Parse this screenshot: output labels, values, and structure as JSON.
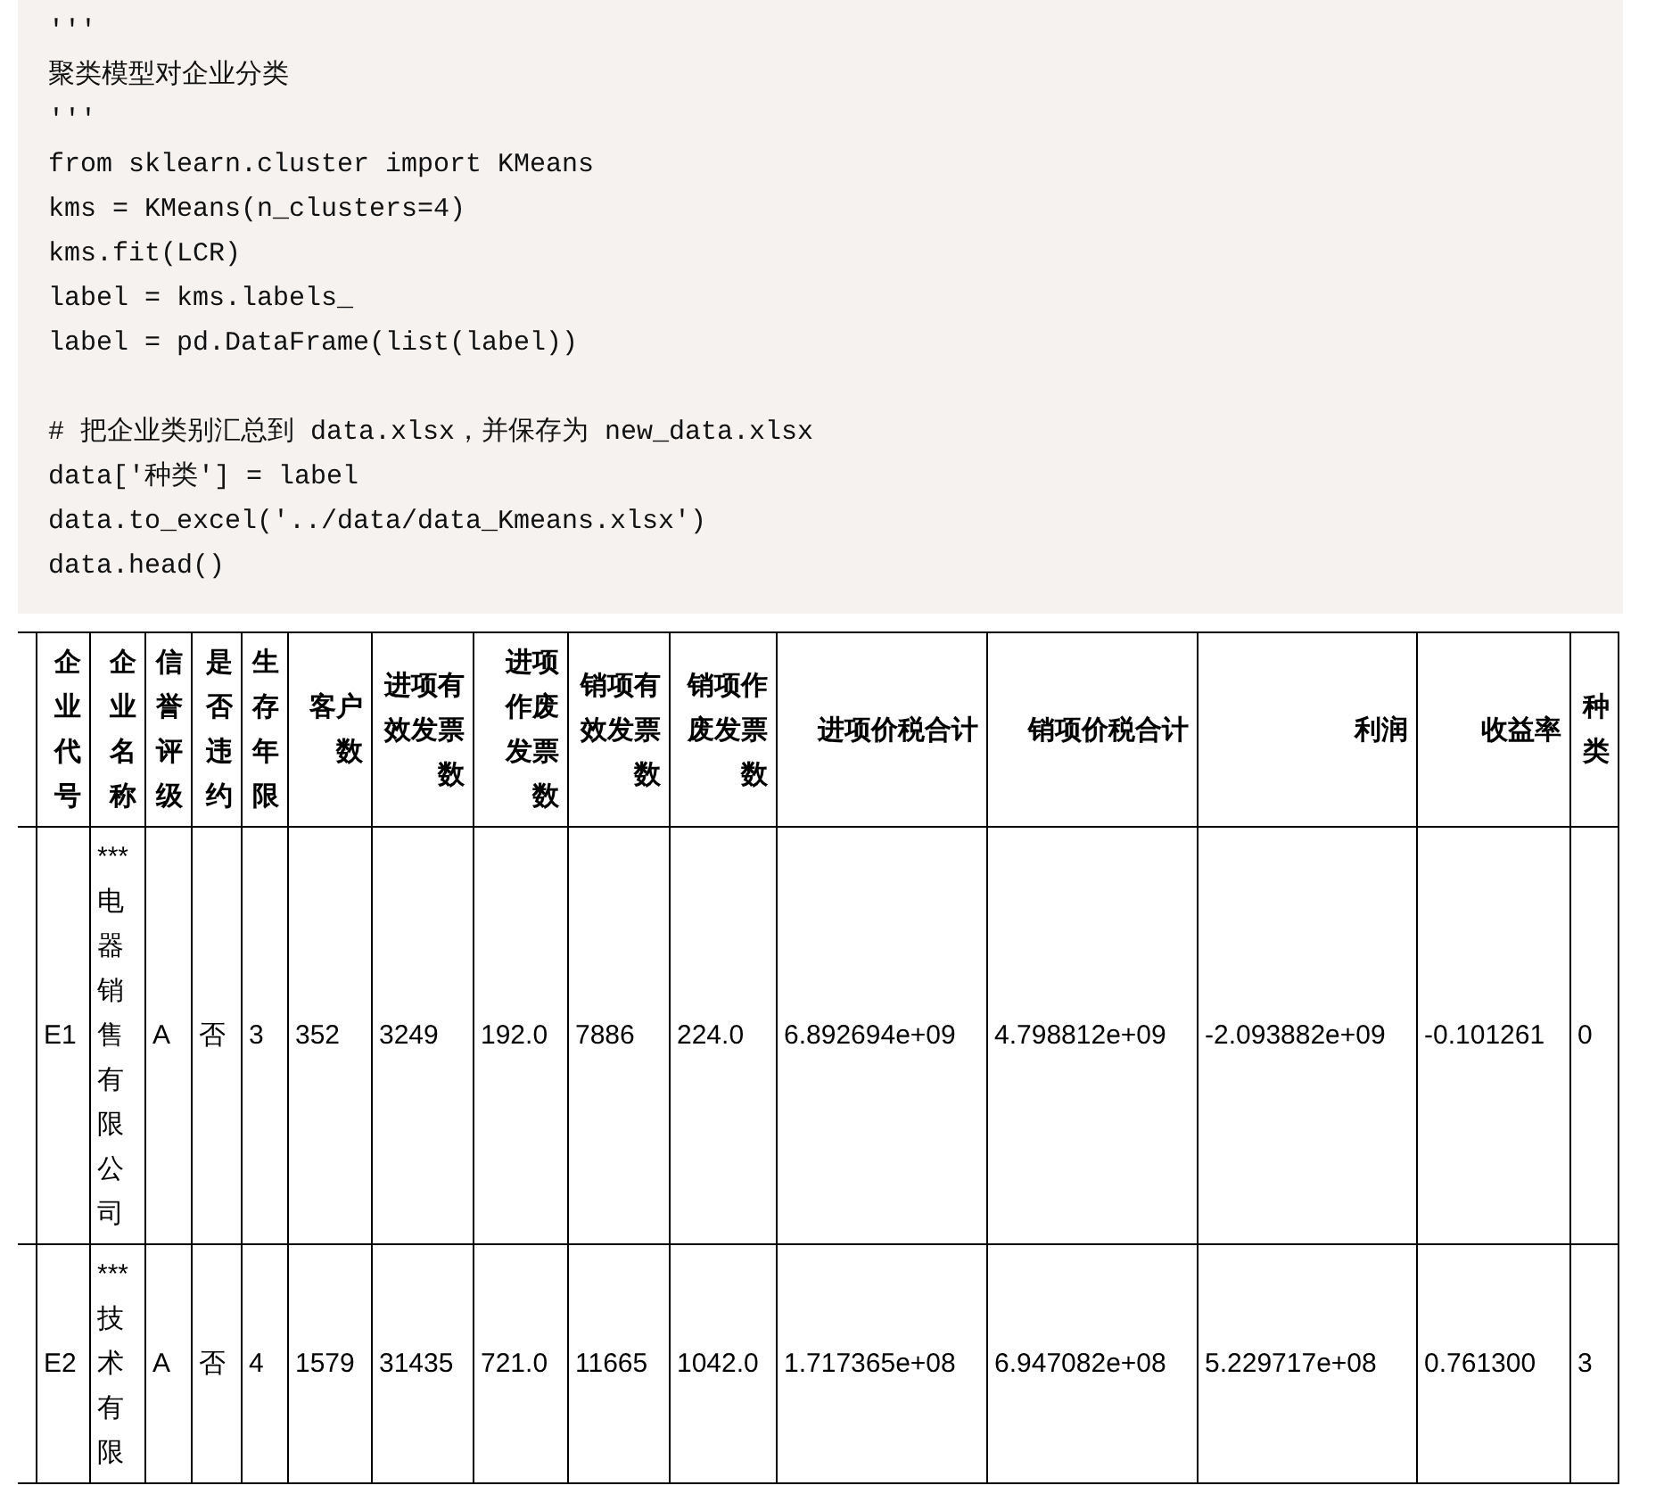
{
  "code_block": {
    "groups": [
      [
        "'''",
        "聚类模型对企业分类",
        "'''",
        "from sklearn.cluster import KMeans",
        "kms = KMeans(n_clusters=4)",
        "kms.fit(LCR)",
        "label = kms.labels_",
        "label = pd.DataFrame(list(label))"
      ],
      [
        "# 把企业类别汇总到 data.xlsx，并保存为 new_data.xlsx",
        "data['种类'] = label",
        "data.to_excel('../data/data_Kmeans.xlsx')",
        "data.head()"
      ]
    ]
  },
  "table": {
    "columns": [
      "企业代号",
      "企业名称",
      "信誉评级",
      "是否违约",
      "生存年限",
      "客户数",
      "进项有效发票数",
      "进项作废发票数",
      "销项有效发票数",
      "销项作废发票数",
      "进项价税合计",
      "销项价税合计",
      "利润",
      "收益率",
      "种类"
    ],
    "rows": [
      [
        "E1",
        "***电器销售有限公司",
        "A",
        "否",
        "3",
        "352",
        "3249",
        "192.0",
        "7886",
        "224.0",
        "6.892694e+09",
        "4.798812e+09",
        "-2.093882e+09",
        "-0.101261",
        "0"
      ],
      [
        "E2",
        "***技术有限",
        "A",
        "否",
        "4",
        "1579",
        "31435",
        "721.0",
        "11665",
        "1042.0",
        "1.717365e+08",
        "6.947082e+08",
        "5.229717e+08",
        "0.761300",
        "3"
      ]
    ]
  }
}
